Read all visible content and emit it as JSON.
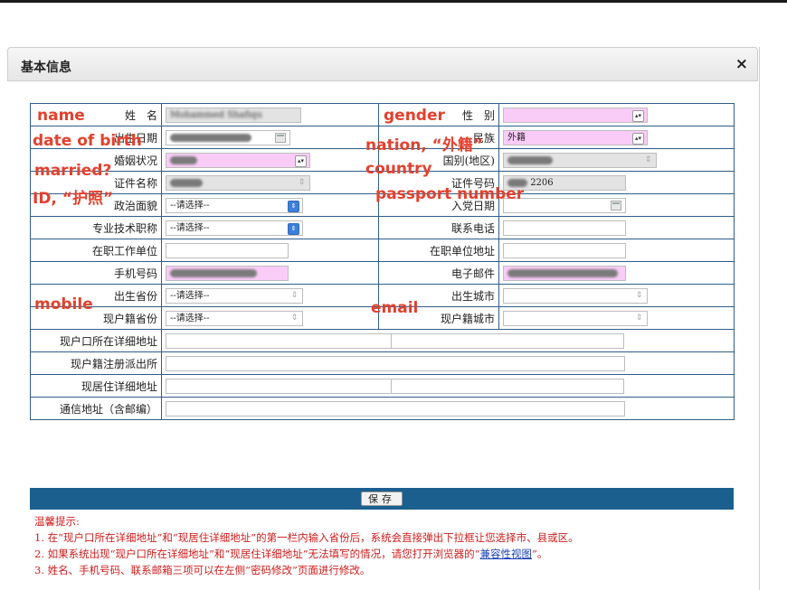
{
  "dialog": {
    "title": "基本信息",
    "close_label": "×"
  },
  "labels": {
    "name": "姓　名",
    "gender": "性　别",
    "birth": "出生日期",
    "nation": "民族",
    "marital": "婚姻状况",
    "country": "国别(地区)",
    "idtype": "证件名称",
    "idnum": "证件号码",
    "political": "政治面貌",
    "party_date": "入党日期",
    "title": "专业技术职称",
    "phone": "联系电话",
    "employer": "在职工作单位",
    "employer_addr": "在职单位地址",
    "mobile": "手机号码",
    "email": "电子邮件",
    "birth_prov": "出生省份",
    "birth_city": "出生城市",
    "hukou_prov": "现户籍省份",
    "hukou_city": "现户籍城市",
    "hukou_addr": "现户口所在详细地址",
    "police": "现户籍注册派出所",
    "residence": "现居住详细地址",
    "mail_addr": "通信地址（含邮编）"
  },
  "values": {
    "name_value": "Mohammed Shafiqu",
    "nation_value": "外籍",
    "passport_suffix": "2206",
    "select_placeholder": "--请选择--"
  },
  "annotations": {
    "name": "name",
    "gender": "gender",
    "dob": "date of birth",
    "nation": "nation, “外籍”",
    "married": "married?",
    "country": "country",
    "id": "ID, “护照”",
    "passport": "passport number",
    "mobile": "mobile",
    "email": "email"
  },
  "buttons": {
    "save": "保存"
  },
  "notes": {
    "heading": "温馨提示:",
    "line1": "1. 在“现户口所在详细地址”和“现居住详细地址”的第一栏内输入省份后，系统会直接弹出下拉框让您选择市、县或区。",
    "line2_pre": "2. 如果系统出现“现户口所在详细地址”和“现居住详细地址”无法填写的情况，请您打开浏览器的“",
    "line2_link": "兼容性视图",
    "line2_post": "”。",
    "line3": "3. 姓名、手机号码、联系邮箱三项可以在左侧“密码修改”页面进行修改。"
  },
  "colors": {
    "annotation": "#e3402d",
    "border": "#2f5d8a",
    "bar": "#1b5f8e",
    "highlight": "#f9ccf7",
    "notes": "#d01b1b"
  }
}
